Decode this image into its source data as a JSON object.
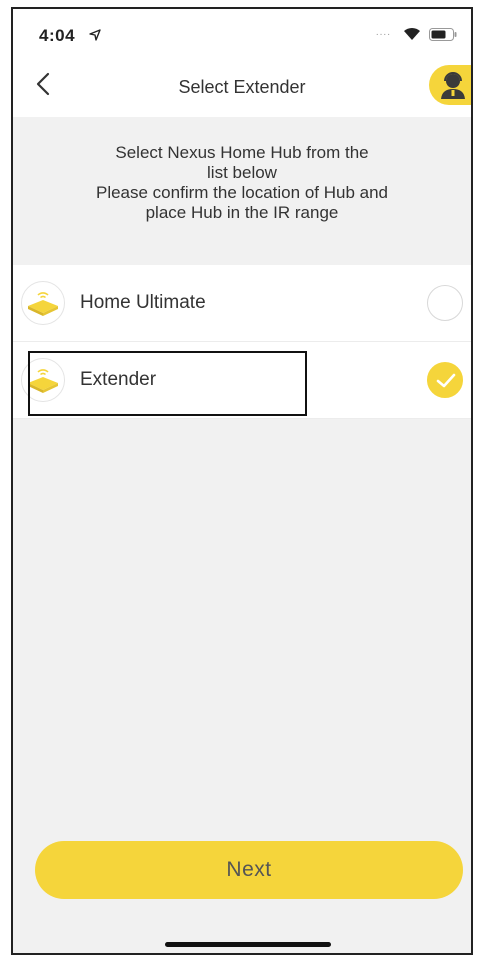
{
  "status_bar": {
    "time": "4:04",
    "signal": "....",
    "icons": [
      "location-arrow-icon",
      "wifi-icon",
      "battery-icon"
    ]
  },
  "nav": {
    "title": "Select Extender",
    "back_icon": "chevron-left-icon",
    "support_icon": "customer-support-icon"
  },
  "instructions": {
    "lines": [
      "Select Nexus Home Hub from the",
      "list below",
      "Please confirm the location of Hub and",
      "place Hub in the IR range"
    ]
  },
  "hub_list": [
    {
      "label": "Home Ultimate",
      "selected": false,
      "icon": "hub-device-icon"
    },
    {
      "label": "Extender",
      "selected": true,
      "icon": "hub-device-icon"
    }
  ],
  "next_button": {
    "label": "Next"
  },
  "colors": {
    "accent": "#f5d53b",
    "background": "#f1f1f1",
    "text": "#333333"
  }
}
